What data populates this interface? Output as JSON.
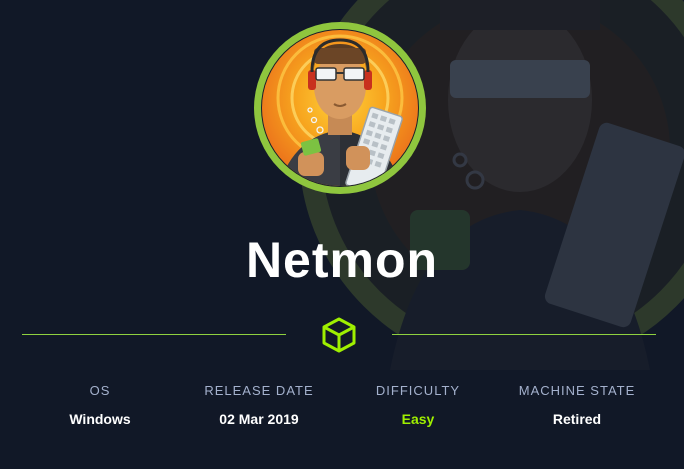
{
  "machine": {
    "name": "Netmon",
    "icon": "cube-icon"
  },
  "stats": [
    {
      "label": "OS",
      "value": "Windows"
    },
    {
      "label": "RELEASE DATE",
      "value": "02 Mar 2019"
    },
    {
      "label": "DIFFICULTY",
      "value": "Easy"
    },
    {
      "label": "MACHINE STATE",
      "value": "Retired"
    }
  ],
  "colors": {
    "background": "#111827",
    "accent": "#9fef00",
    "label": "#a4b1cd"
  }
}
